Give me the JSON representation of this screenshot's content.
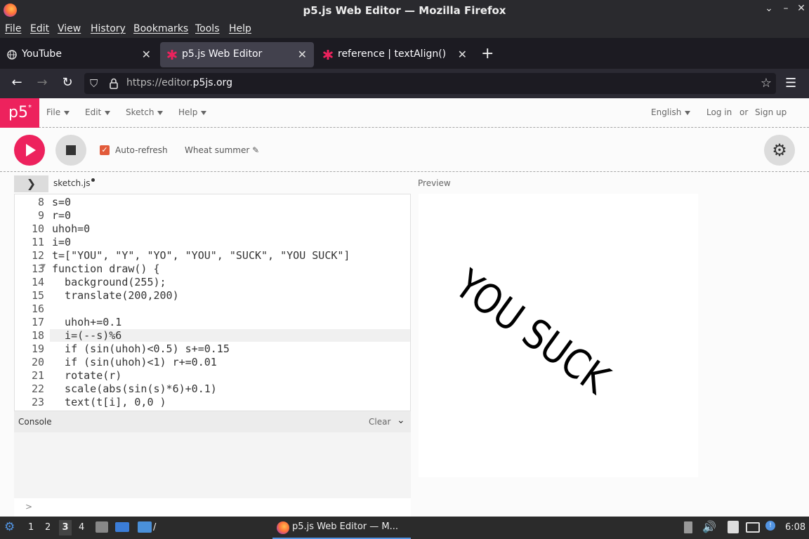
{
  "window": {
    "title": "p5.js Web Editor — Mozilla Firefox"
  },
  "menubar": [
    "File",
    "Edit",
    "View",
    "History",
    "Bookmarks",
    "Tools",
    "Help"
  ],
  "tabs": [
    {
      "label": "YouTube",
      "active": false
    },
    {
      "label": "p5.js Web Editor",
      "active": true
    },
    {
      "label": "reference | textAlign()",
      "active": false
    }
  ],
  "url": {
    "prefix": "https://editor.",
    "domain": "p5js.org"
  },
  "p5": {
    "logo": "p5",
    "logo_mark": "*",
    "menus": [
      "File",
      "Edit",
      "Sketch",
      "Help"
    ],
    "language": "English",
    "login": "Log in",
    "or": "or",
    "signup": "Sign up",
    "auto_refresh": "Auto-refresh",
    "sketch_name": "Wheat summer",
    "file_tab": "sketch.js",
    "preview_label": "Preview",
    "console": {
      "title": "Console",
      "clear": "Clear",
      "prompt": ">"
    },
    "canvas_text": "YOU SUCK"
  },
  "code": {
    "line_numbers": [
      "8",
      "9",
      "10",
      "11",
      "12",
      "13",
      "14",
      "15",
      "16",
      "17",
      "18",
      "19",
      "20",
      "21",
      "22",
      "23"
    ],
    "lines": [
      "s=0",
      "r=0",
      "uhoh=0",
      "i=0",
      "t=[\"YOU\", \"Y\", \"YO\", \"YOU\", \"SUCK\", \"YOU SUCK\"]",
      "function draw() {",
      "  background(255);",
      "  translate(200,200)",
      "",
      "  uhoh+=0.1",
      "  i=(--s)%6",
      "  if (sin(uhoh)<0.5) s+=0.15",
      "  if (sin(uhoh)<1) r+=0.01",
      "  rotate(r)",
      "  scale(abs(sin(s)*6)+0.1)",
      "  text(t[i], 0,0 )"
    ]
  },
  "taskbar": {
    "workspaces": [
      "1",
      "2",
      "3",
      "4"
    ],
    "active_task": "p5.js Web Editor — M...",
    "clock": "6:08"
  },
  "colors": {
    "p5_pink": "#ed225d",
    "checkbox": "#e25b3a"
  }
}
